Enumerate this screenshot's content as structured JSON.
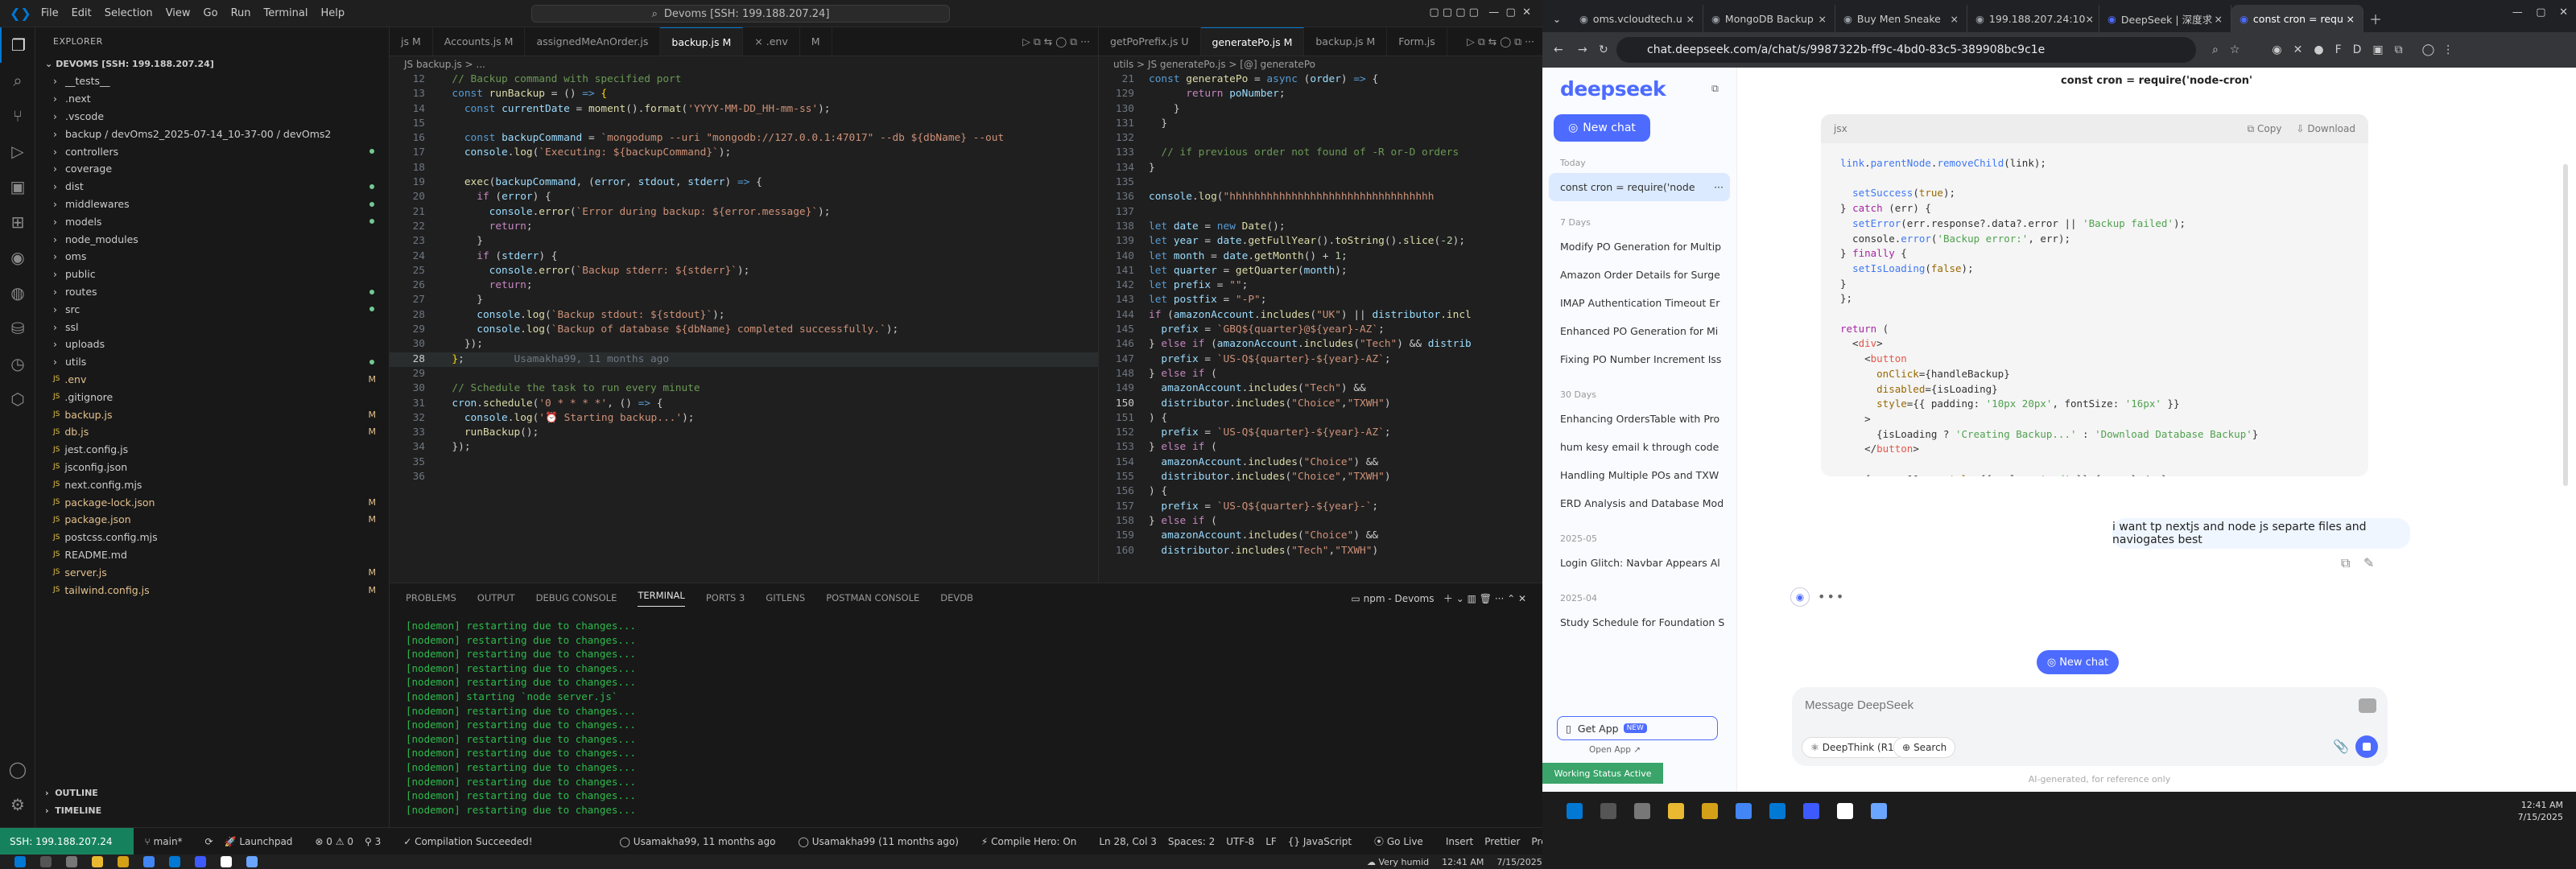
{
  "vscode": {
    "menu": [
      "File",
      "Edit",
      "Selection",
      "View",
      "Go",
      "Run",
      "Terminal",
      "Help"
    ],
    "command_center": "Devoms [SSH: 199.188.207.24]",
    "explorer_title": "EXPLORER",
    "project": "DEVOMS [SSH: 199.188.207.24]",
    "tree": [
      {
        "name": "__tests__",
        "t": "d"
      },
      {
        "name": ".next",
        "t": "d"
      },
      {
        "name": ".vscode",
        "t": "d"
      },
      {
        "name": "backup / devOms2_2025-07-14_10-37-00 / devOms2",
        "t": "d"
      },
      {
        "name": "controllers",
        "t": "d",
        "dot": true
      },
      {
        "name": "coverage",
        "t": "d"
      },
      {
        "name": "dist",
        "t": "d",
        "dot": true
      },
      {
        "name": "middlewares",
        "t": "d",
        "dot": true
      },
      {
        "name": "models",
        "t": "d",
        "dot": true
      },
      {
        "name": "node_modules",
        "t": "d"
      },
      {
        "name": "oms",
        "t": "d"
      },
      {
        "name": "public",
        "t": "d"
      },
      {
        "name": "routes",
        "t": "d",
        "dot": true
      },
      {
        "name": "src",
        "t": "d",
        "dot": true
      },
      {
        "name": "ssl",
        "t": "d"
      },
      {
        "name": "uploads",
        "t": "d"
      },
      {
        "name": "utils",
        "t": "d",
        "dot": true
      },
      {
        "name": ".env",
        "t": "f",
        "m": "M"
      },
      {
        "name": ".gitignore",
        "t": "f"
      },
      {
        "name": "backup.js",
        "t": "f",
        "m": "M"
      },
      {
        "name": "db.js",
        "t": "f",
        "m": "M"
      },
      {
        "name": "jest.config.js",
        "t": "f"
      },
      {
        "name": "jsconfig.json",
        "t": "f"
      },
      {
        "name": "next.config.mjs",
        "t": "f"
      },
      {
        "name": "package-lock.json",
        "t": "f",
        "m": "M"
      },
      {
        "name": "package.json",
        "t": "f",
        "m": "M"
      },
      {
        "name": "postcss.config.mjs",
        "t": "f"
      },
      {
        "name": "README.md",
        "t": "f"
      },
      {
        "name": "server.js",
        "t": "f",
        "m": "M"
      },
      {
        "name": "tailwind.config.js",
        "t": "f",
        "m": "M"
      }
    ],
    "outline": "OUTLINE",
    "timeline": "TIMELINE",
    "ed1_tabs": [
      "js M",
      "Accounts.js M",
      "assignedMeAnOrder.js",
      "backup.js M",
      "× .env",
      "M"
    ],
    "ed1_crumb": "JS backup.js > ...",
    "ed2_tabs": [
      "getPoPrefix.js U",
      "generatePo.js M",
      "backup.js M",
      "Form.js"
    ],
    "ed2_crumb": "utils > JS generatePo.js > [@] generatePo",
    "panel_tabs": [
      "PROBLEMS",
      "OUTPUT",
      "DEBUG CONSOLE",
      "TERMINAL",
      "PORTS 3",
      "GITLENS",
      "POSTMAN CONSOLE",
      "DEVDB"
    ],
    "term_title": "npm - Devoms",
    "terminal": [
      "[nodemon] restarting due to changes...",
      "[nodemon] restarting due to changes...",
      "[nodemon] restarting due to changes...",
      "[nodemon] restarting due to changes...",
      "[nodemon] restarting due to changes...",
      "[nodemon] starting `node server.js`",
      "[nodemon] restarting due to changes...",
      "[nodemon] restarting due to changes...",
      "[nodemon] restarting due to changes...",
      "[nodemon] restarting due to changes...",
      "[nodemon] restarting due to changes...",
      "[nodemon] restarting due to changes...",
      "[nodemon] restarting due to changes...",
      "[nodemon] restarting due to changes..."
    ],
    "status": {
      "ssh": "SSH: 199.188.207.24",
      "branch": "main*",
      "launchpad": "Launchpad",
      "problems": "⊗ 0 ⚠ 0",
      "ports": "3",
      "compile": "Compilation Succeeded!",
      "blame": "Usamakha99, 11 months ago",
      "git": "Usamakha99 (11 months ago)",
      "compile_hero": "Compile Hero: On",
      "pos": "Ln 28, Col 3",
      "spaces": "Spaces: 2",
      "enc": "UTF-8",
      "eol": "LF",
      "lang": "JavaScript",
      "golive": "Go Live",
      "insert": "Insert",
      "prettier": "Prettier",
      "weather": "Very humid",
      "time": "12:41 AM",
      "date": "7/15/2025"
    }
  },
  "chrome": {
    "tabs": [
      "oms.vcloudtech.u",
      "MongoDB Backup",
      "Buy Men Sneake",
      "199.188.207.24:10",
      "DeepSeek | 深度求",
      "const cron = requ"
    ],
    "url": "chat.deepseek.com/a/chat/s/9987322b-ff9c-4bd0-83c5-389908bc9c1e"
  },
  "deepseek": {
    "logo": "deepseek",
    "new_chat": "New chat",
    "today": "Today",
    "current": "const cron = require('node",
    "groups": [
      {
        "label": "7 Days",
        "items": [
          "Modify PO Generation for Multip",
          "Amazon Order Details for Surge",
          "IMAP Authentication Timeout Er",
          "Enhanced PO Generation for Mi",
          "Fixing PO Number Increment Iss"
        ]
      },
      {
        "label": "30 Days",
        "items": [
          "Enhancing OrdersTable with Pro",
          "hum kesy email k through code",
          "Handling Multiple POs and TXW",
          "ERD Analysis and Database Mod"
        ]
      },
      {
        "label": "2025-05",
        "items": [
          "Login Glitch: Navbar Appears Al"
        ]
      },
      {
        "label": "2025-04",
        "items": [
          "Study Schedule for Foundation S"
        ]
      }
    ],
    "get_app": "Get App",
    "new_badge": "NEW",
    "open_app": "Open App ↗",
    "working": "Working Status Active",
    "chat_title": "const cron = require('node-cron'",
    "code_lang": "jsx",
    "copy": "Copy",
    "download": "Download",
    "user_msg": "i want tp nextjs and node js separte files and naviogates best",
    "new_chat2": "New chat",
    "placeholder": "Message DeepSeek",
    "deepthink": "DeepThink (R1)",
    "search": "Search",
    "disclaimer": "AI-generated, for reference only",
    "clock": "12:41 AM",
    "clock_date": "7/15/2025"
  }
}
